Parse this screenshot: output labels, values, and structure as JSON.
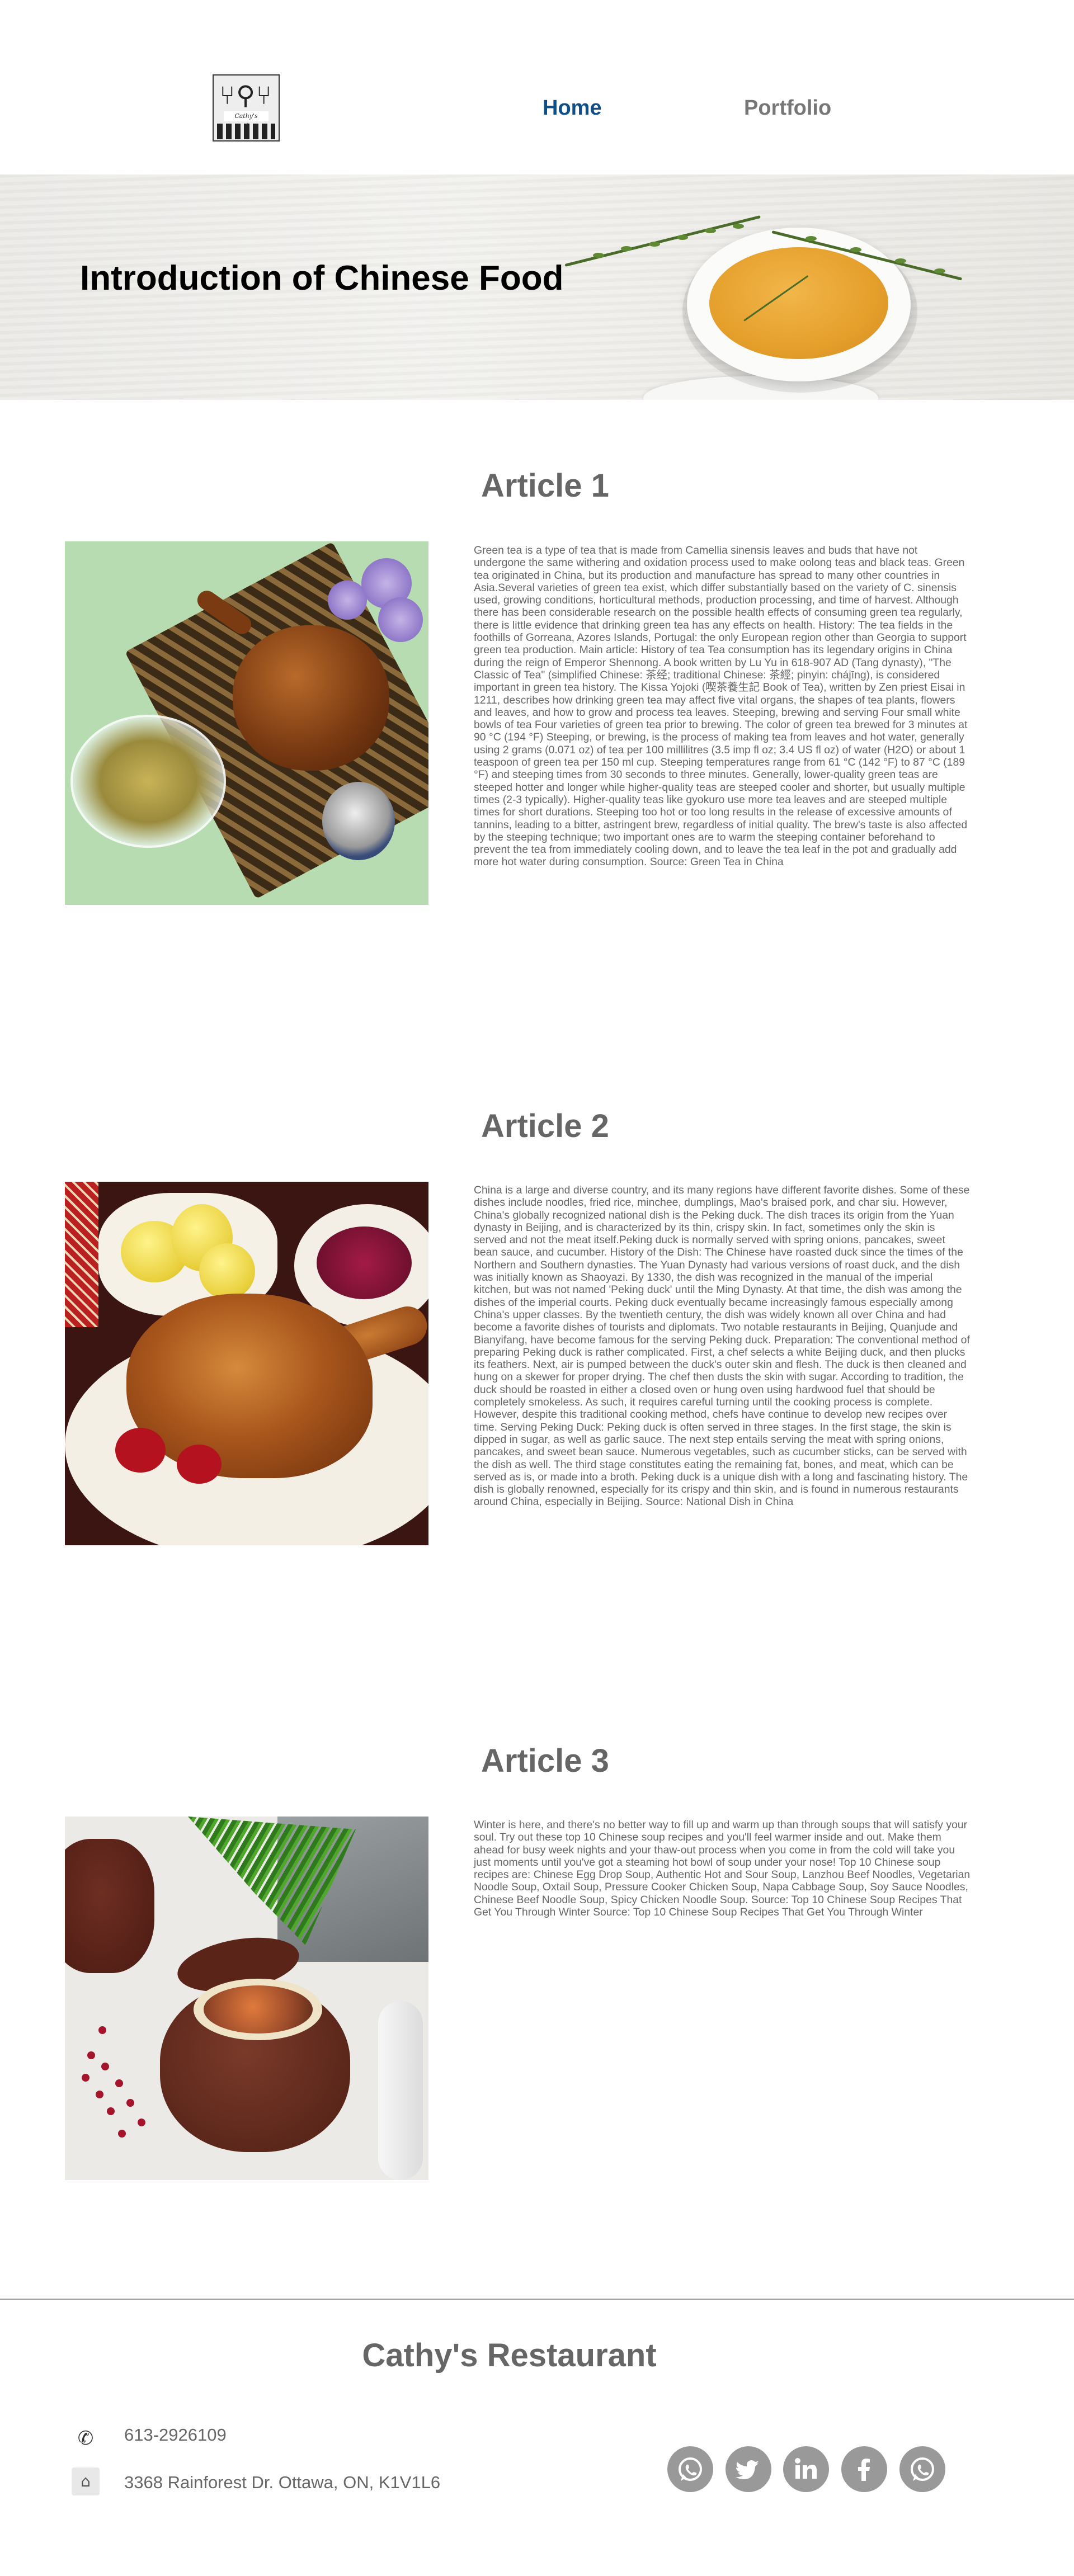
{
  "header": {
    "logo_text": "Cathy's Kitchen",
    "nav": {
      "home": "Home",
      "portfolio": "Portfolio"
    },
    "accent_color": "#0e4f8a"
  },
  "banner": {
    "title": "Introduction of Chinese Food"
  },
  "articles": [
    {
      "title": "Article 1",
      "image_icon": "green-tea-image",
      "text": "Green tea is a type of tea that is made from Camellia sinensis leaves and buds that have not undergone the same withering and oxidation process used to make oolong teas and black teas. Green tea originated in China, but its production and manufacture has spread to many other countries in Asia.Several varieties of green tea exist, which differ substantially based on the variety of C. sinensis used, growing conditions, horticultural methods, production processing, and time of harvest. Although there has been considerable research on the possible health effects of consuming green tea regularly, there is little evidence that drinking green tea has any effects on health. History: The tea fields in the foothills of Gorreana, Azores Islands, Portugal: the only European region other than Georgia to support green tea production. Main article: History of tea Tea consumption has its legendary origins in China during the reign of Emperor Shennong. A book written by Lu Yu in 618-907 AD (Tang dynasty), \"The Classic of Tea\" (simplified Chinese: 茶经; traditional Chinese: 茶經; pinyin: chájīng), is considered important in green tea history. The Kissa Yojoki (喫茶養生記 Book of Tea), written by Zen priest Eisai in 1211, describes how drinking green tea may affect five vital organs, the shapes of tea plants, flowers and leaves, and how to grow and process tea leaves.  Steeping, brewing and serving Four small white bowls of tea Four varieties of green tea prior to brewing. The color of green tea brewed for 3 minutes at 90 °C (194 °F) Steeping, or brewing, is the process of making tea from leaves and hot water, generally using 2 grams (0.071 oz) of tea per 100 millilitres (3.5 imp fl oz; 3.4 US fl oz) of water (H2O) or about 1 teaspoon of green tea per 150 ml cup. Steeping temperatures range from 61 °C (142 °F) to 87 °C (189 °F) and steeping times from 30 seconds to three minutes. Generally, lower-quality green teas are steeped hotter and longer while higher-quality teas are steeped cooler and shorter, but usually multiple times (2-3 typically). Higher-quality teas like gyokuro use more tea leaves and are steeped multiple times for short durations. Steeping too hot or too long results in the release of excessive amounts of tannins, leading to a bitter, astringent brew, regardless of initial quality. The brew's taste is also affected by the steeping technique; two important ones are to warm the steeping container beforehand to prevent the tea from immediately cooling down, and to leave the tea leaf in the pot and gradually add more hot water during consumption. Source: Green Tea in China"
    },
    {
      "title": "Article 2",
      "image_icon": "roast-duck-image",
      "text": "China is a large and diverse country, and its many regions have different favorite dishes. Some of these dishes include noodles, fried rice, minchee, dumplings, Mao's braised pork, and char siu. However, China's globally recognized national dish is the Peking duck. The dish traces its origin from the Yuan dynasty in Beijing, and is characterized by its thin, crispy skin. In fact, sometimes only the skin is served and not the meat itself.Peking duck is normally served with spring onions, pancakes, sweet bean sauce, and cucumber. History of the Dish: The Chinese have roasted duck since the times of the Northern and Southern dynasties. The Yuan Dynasty had various versions of roast duck, and the dish was initially known as Shaoyazi. By 1330, the dish was recognized in the manual of the imperial kitchen, but was not named 'Peking duck' until the Ming Dynasty. At that time, the dish was among the dishes of the imperial courts. Peking duck eventually became increasingly famous especially among China's upper classes. By the twentieth century, the dish was widely known all over China and had become a favorite dishes of tourists and diplomats. Two notable restaurants in Beijing, Quanjude and Bianyifang, have become famous for the serving Peking duck. Preparation: The conventional method of preparing Peking duck is rather complicated. First, a chef selects a white Beijing duck, and then plucks its feathers. Next, air is pumped between the duck's outer skin and flesh. The duck is then cleaned and hung on a skewer for proper drying. The chef then dusts the skin with sugar. According to tradition, the duck should be roasted in either a closed oven or hung oven using hardwood fuel that should be completely smokeless. As such, it requires careful turning until the cooking process is complete. However, despite this traditional cooking method, chefs have continue to develop new recipes over time.  Serving Peking Duck: Peking duck is often served in three stages. In the first stage, the skin is dipped in sugar, as well as garlic sauce. The next step entails serving the meat with spring onions, pancakes, and sweet bean sauce. Numerous vegetables, such as cucumber sticks, can be served with the dish as well. The third stage constitutes eating the remaining fat, bones, and meat, which can be served as is, or made into a broth. Peking duck is a unique dish with a long and fascinating history. The dish is globally renowned, especially for its crispy and thin skin, and is found in numerous restaurants around China, especially in Beijing. Source: National Dish in China"
    },
    {
      "title": "Article 3",
      "image_icon": "chinese-soup-image",
      "text": "Winter is here, and there's no better way to fill up and warm up than through soups that will satisfy your soul. Try out these top 10 Chinese soup recipes and you'll feel warmer inside and out. Make them ahead for busy week nights and your thaw-out process when you come in from the cold will take you just moments until you've got a steaming hot bowl of soup under your nose! Top 10 Chinese soup recipes are: Chinese Egg Drop Soup, Authentic Hot and Sour Soup, Lanzhou Beef Noodles, Vegetarian Noodle Soup, Oxtail Soup, Pressure Cooker Chicken Soup, Napa Cabbage Soup, Soy Sauce Noodles, Chinese Beef Noodle Soup, Spicy Chicken Noodle Soup. Source: Top 10 Chinese Soup Recipes That Get You Through Winter  Source: Top 10 Chinese Soup Recipes That Get You Through Winter"
    }
  ],
  "footer": {
    "title": "Cathy's Restaurant",
    "phone_icon": "phone-icon",
    "phone": "613-2926109",
    "address_icon": "home-icon",
    "address": "3368 Rainforest Dr. Ottawa, ON, K1V1L6",
    "social": [
      "whatsapp-icon",
      "twitter-icon",
      "linkedin-icon",
      "facebook-icon",
      "whatsapp-icon"
    ],
    "social_color": "#999999"
  }
}
